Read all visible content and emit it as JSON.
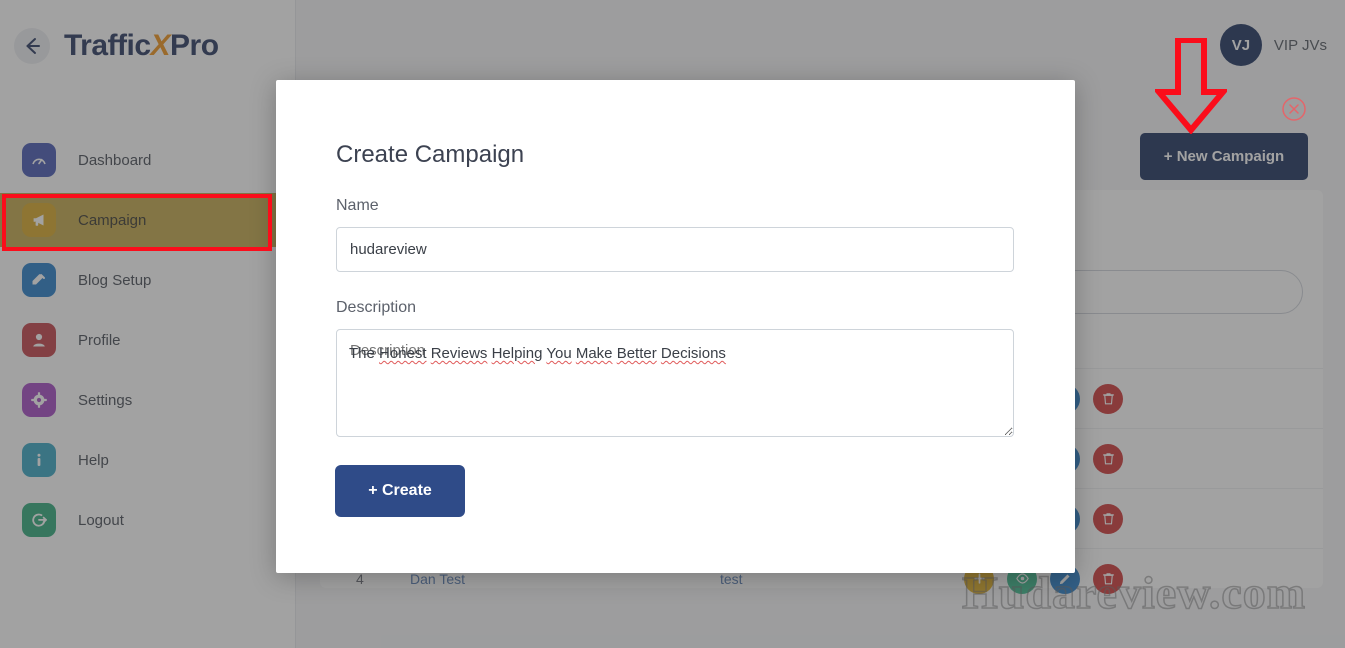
{
  "brand": {
    "name_part1": "Traffic",
    "name_x": "X",
    "name_part2": "Pro",
    "back_icon": "arrow-left-icon"
  },
  "sidebar": {
    "items": [
      {
        "label": "Dashboard",
        "icon": "speedometer-icon",
        "color": "#4a5bb5",
        "active": false
      },
      {
        "label": "Campaign",
        "icon": "megaphone-icon",
        "color": "#d8a92b",
        "active": true
      },
      {
        "label": "Blog Setup",
        "icon": "blog-pen-icon",
        "color": "#2a7fc9",
        "active": false
      },
      {
        "label": "Profile",
        "icon": "user-icon",
        "color": "#c4434b",
        "active": false
      },
      {
        "label": "Settings",
        "icon": "gear-icon",
        "color": "#a54bc4",
        "active": false
      },
      {
        "label": "Help",
        "icon": "info-icon",
        "color": "#3aa8c4",
        "active": false
      },
      {
        "label": "Logout",
        "icon": "logout-icon",
        "color": "#33ab7e",
        "active": false
      }
    ]
  },
  "topbar": {
    "avatar_initials": "VJ",
    "user_name": "VIP JVs",
    "new_campaign_label": "+ New Campaign"
  },
  "modal": {
    "title": "Create Campaign",
    "close_icon": "close-circle-icon",
    "name_label": "Name",
    "name_value": "hudareview",
    "name_placeholder": "Name",
    "description_label": "Description",
    "description_value": "The Honest Reviews Helping You Make Better Decisions",
    "description_placeholder": "Description",
    "description_words": {
      "w0": "The ",
      "w1": "Honest",
      "w2": "Reviews",
      "w3": "Helping",
      "w4": "You",
      "w5": "Make",
      "w6": "Better",
      "w7": "Decisions"
    },
    "create_label": "+ Create"
  },
  "table": {
    "rows": [
      {
        "id": "",
        "name": "",
        "description": "",
        "actions": [
          "edit-icon",
          "delete-icon"
        ]
      },
      {
        "id": "",
        "name": "",
        "description": "",
        "actions": [
          "edit-icon",
          "delete-icon"
        ]
      },
      {
        "id": "",
        "name": "",
        "description": "",
        "actions": [
          "edit-icon",
          "delete-icon"
        ]
      },
      {
        "id": "4",
        "name": "Dan Test",
        "description": "test",
        "actions": [
          "add-icon",
          "view-icon",
          "edit-icon",
          "delete-icon"
        ]
      }
    ]
  },
  "watermark": {
    "text": "Hudareview.com"
  },
  "annotations": {
    "arrow": "red-down-arrow",
    "highlight_box": "red-rectangle-campaign"
  },
  "colors": {
    "accent_navy": "#1f3461",
    "brand_orange": "#f0941e",
    "annotation_red": "#fb0d1b",
    "active_nav": "#c3a94e",
    "create_button": "#2f4b88"
  }
}
